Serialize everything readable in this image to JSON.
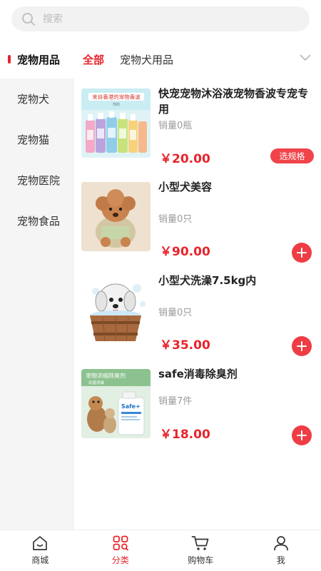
{
  "search": {
    "placeholder": "搜索"
  },
  "sidebar": {
    "items": [
      {
        "label": "宠物用品",
        "active": true
      },
      {
        "label": "宠物犬"
      },
      {
        "label": "宠物猫"
      },
      {
        "label": "宠物医院"
      },
      {
        "label": "宠物食品"
      }
    ]
  },
  "subtabs": [
    {
      "label": "全部",
      "active": true
    },
    {
      "label": "宠物犬用品"
    }
  ],
  "products": [
    {
      "title": "快宠宠物沐浴液宠物香波专宠专用",
      "sales": "销量0瓶",
      "price": "￥20.00",
      "action": "选规格",
      "image_text": "来自香港的宠物香波",
      "image_subtext": "你的"
    },
    {
      "title": "小型犬美容",
      "sales": "销量0只",
      "price": "￥90.00"
    },
    {
      "title": "小型犬洗澡7.5kg内",
      "sales": "销量0只",
      "price": "￥35.00"
    },
    {
      "title": "safe消毒除臭剂",
      "sales": "销量7件",
      "price": "￥18.00",
      "image_text": "宠物浓缩除臭剂",
      "image_subtext": "杀菌消毒",
      "image_bottle_label": "Safe+"
    }
  ],
  "bottom_nav": [
    {
      "label": "商城",
      "icon": "home-icon"
    },
    {
      "label": "分类",
      "icon": "category-icon",
      "active": true
    },
    {
      "label": "购物车",
      "icon": "cart-icon"
    },
    {
      "label": "我",
      "icon": "user-icon"
    }
  ],
  "colors": {
    "accent": "#e8232b",
    "sidebar_bg": "#f5f5f5",
    "price": "#e8232b"
  }
}
